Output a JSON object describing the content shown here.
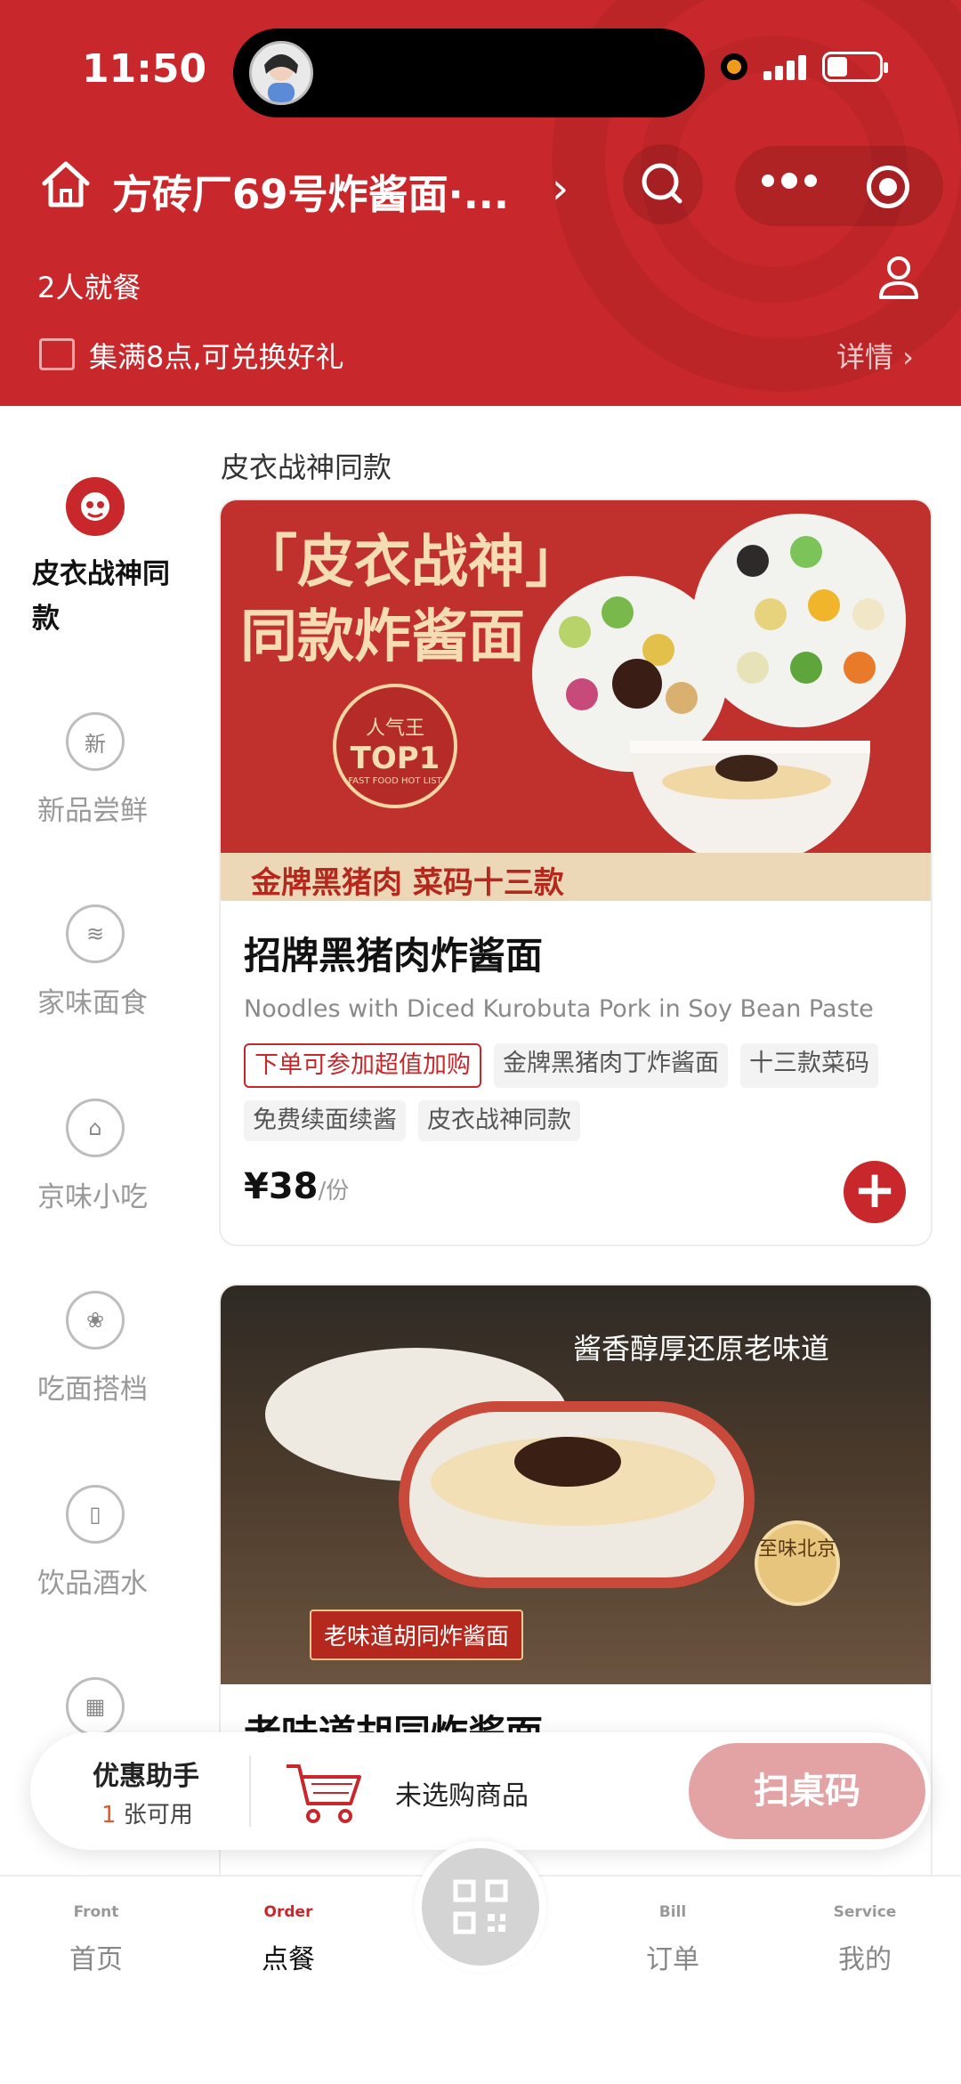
{
  "status_bar": {
    "time": "11:50"
  },
  "header": {
    "store_title": "方砖厂69号炸酱面·...",
    "diners": "2人就餐",
    "promo_text": "集满8点,可兑换好礼",
    "promo_detail": "详情 ›",
    "colors": {
      "brand": "#c8282b"
    }
  },
  "sidebar": {
    "items": [
      {
        "label": "皮衣战神同款",
        "icon": "mascot-icon",
        "active": true
      },
      {
        "label": "新品尝鲜",
        "icon": "new-icon",
        "glyph": "新"
      },
      {
        "label": "家味面食",
        "icon": "noodle-bowl-icon",
        "glyph": "≋"
      },
      {
        "label": "京味小吃",
        "icon": "temple-icon",
        "glyph": "⌂"
      },
      {
        "label": "吃面搭档",
        "icon": "vegetable-icon",
        "glyph": "❀"
      },
      {
        "label": "饮品酒水",
        "icon": "cup-icon",
        "glyph": "▯"
      },
      {
        "label": "",
        "icon": "gift-icon",
        "glyph": "▦"
      }
    ]
  },
  "main": {
    "section_title": "皮衣战神同款",
    "products": [
      {
        "banner": {
          "headline_1": "「皮衣战神」",
          "headline_2": "同款炸酱面",
          "badge_1": "人气王",
          "badge_2": "TOP1",
          "badge_3": "FAST FOOD HOT LIST",
          "strip": "金牌黑猪肉 菜码十三款"
        },
        "name": "招牌黑猪肉炸酱面",
        "name_en": "Noodles with Diced Kurobuta Pork in Soy Bean Paste",
        "tags": [
          "下单可参加超值加购",
          "金牌黑猪肉丁炸酱面",
          "十三款菜码",
          "免费续面续酱",
          "皮衣战神同款"
        ],
        "price": "¥38",
        "unit": "/份"
      },
      {
        "banner": {
          "headline": "酱香醇厚还原老味道",
          "tag": "老味道胡同炸酱面",
          "seal": "至味北京"
        },
        "name": "老味道胡同炸酱面"
      }
    ]
  },
  "bottom_bar": {
    "coupon_title": "优惠助手",
    "coupon_count": "1",
    "coupon_unit": " 张可用",
    "cart_text": "未选购商品",
    "scan_button": "扫桌码"
  },
  "tabbar": {
    "tabs": [
      {
        "en": "Front",
        "zh": "首页"
      },
      {
        "en": "Order",
        "zh": "点餐",
        "active": true
      },
      {
        "en": "Bill",
        "zh": "订单"
      },
      {
        "en": "Service",
        "zh": "我的"
      }
    ]
  }
}
